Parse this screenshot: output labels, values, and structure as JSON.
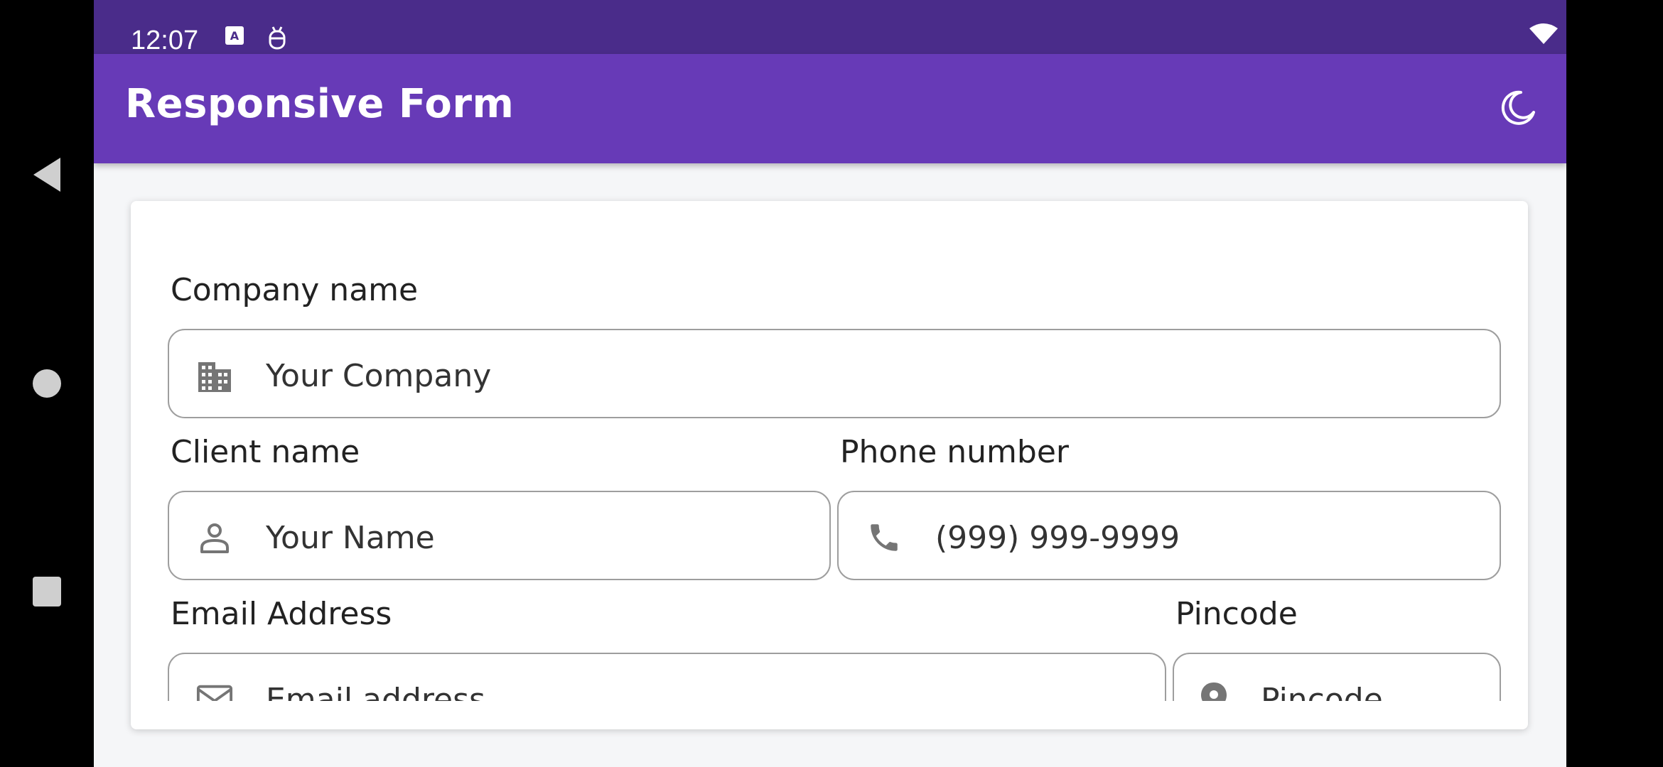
{
  "status": {
    "time": "12:07"
  },
  "appbar": {
    "title": "Responsive Form",
    "theme_icon": "moon-icon"
  },
  "form": {
    "company": {
      "label": "Company name",
      "placeholder": "Your Company",
      "icon": "building-icon"
    },
    "client": {
      "label": "Client name",
      "placeholder": "Your Name",
      "icon": "person-icon"
    },
    "phone": {
      "label": "Phone number",
      "placeholder": "(999) 999-9999",
      "icon": "phone-icon"
    },
    "email": {
      "label": "Email Address",
      "placeholder": "Email address",
      "icon": "mail-icon"
    },
    "pincode": {
      "label": "Pincode",
      "placeholder": "Pincode",
      "icon": "location-pin-icon"
    }
  },
  "colors": {
    "statusbar": "#4a2c8a",
    "appbar": "#673ab7",
    "background": "#f5f6f8"
  }
}
